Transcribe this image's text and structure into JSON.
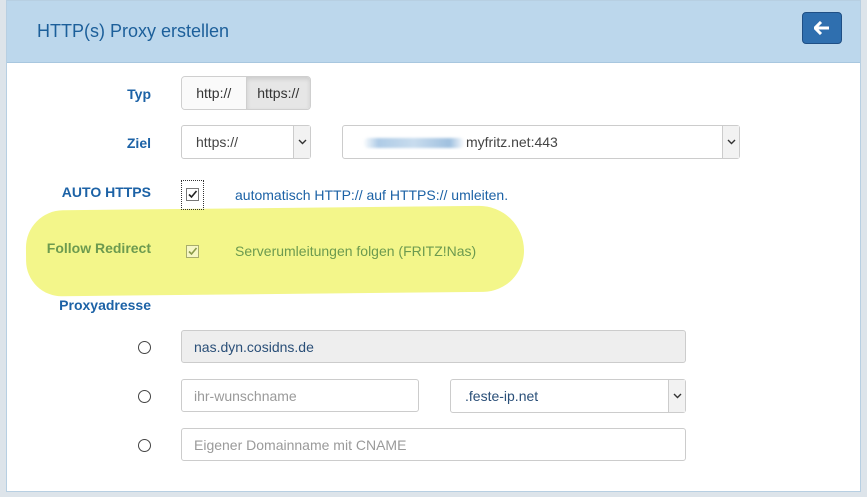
{
  "header": {
    "title": "HTTP(s) Proxy erstellen",
    "back_icon": "arrow-left-icon"
  },
  "typ": {
    "label": "Typ",
    "options": [
      "http://",
      "https://"
    ],
    "selected": "https://"
  },
  "ziel": {
    "label": "Ziel",
    "protocol": "https://",
    "host_suffix": "myfritz.net:443"
  },
  "auto_https": {
    "label": "AUTO HTTPS",
    "checked": true,
    "text": "automatisch HTTP:// auf HTTPS:// umleiten."
  },
  "follow_redirect": {
    "label": "Follow Redirect",
    "checked": true,
    "text": "Serverumleitungen folgen (FRITZ!Nas)"
  },
  "proxy": {
    "label": "Proxyadresse",
    "option1_value": "nas.dyn.cosidns.de",
    "option2_placeholder": "ihr-wunschname",
    "option2_domain": ".feste-ip.net",
    "option3_placeholder": "Eigener Domainname mit CNAME"
  },
  "colors": {
    "accent": "#1c62a6",
    "header_bg": "#bcd7ec",
    "highlight": "#f3f68a",
    "button": "#2f6faf"
  }
}
